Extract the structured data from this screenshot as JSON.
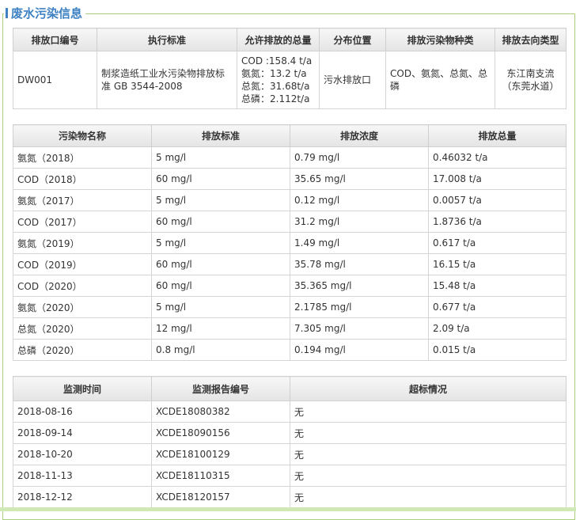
{
  "section_title": "废水污染信息",
  "outlet_table": {
    "headers": [
      "排放口编号",
      "执行标准",
      "允许排放的总量",
      "分布位置",
      "排放污染物种类",
      "排放去向类型"
    ],
    "row": {
      "outlet_id": "DW001",
      "standard": "制浆造纸工业水污染物排放标准 GB 3544-2008",
      "allowed_totals": [
        "COD :158.4 t/a",
        "氨氮：13.2 t/a",
        "总氮：31.68t/a",
        "总磷：2.112t/a"
      ],
      "location": "污水排放口",
      "pollutant_types": "COD、氨氮、总氮、总磷",
      "discharge_destination": "东江南支流（东莞水道）"
    }
  },
  "pollutant_table": {
    "headers": [
      "污染物名称",
      "排放标准",
      "排放浓度",
      "排放总量"
    ],
    "rows": [
      [
        "氨氮（2018）",
        "5 mg/l",
        "0.79 mg/l",
        "0.46032 t/a"
      ],
      [
        "COD（2018）",
        "60 mg/l",
        "35.65 mg/l",
        "17.008 t/a"
      ],
      [
        "氨氮（2017）",
        "5 mg/l",
        "0.12 mg/l",
        "0.0057 t/a"
      ],
      [
        "COD（2017）",
        "60 mg/l",
        "31.2 mg/l",
        "1.8736 t/a"
      ],
      [
        "氨氮（2019）",
        "5 mg/l",
        "1.49 mg/l",
        "0.617 t/a"
      ],
      [
        "COD（2019）",
        "60 mg/l",
        "35.78 mg/l",
        "16.15 t/a"
      ],
      [
        "COD（2020）",
        "60 mg/l",
        "35.365 mg/l",
        "15.48 t/a"
      ],
      [
        "氨氮（2020）",
        "5 mg/l",
        "2.1785 mg/l",
        "0.677 t/a"
      ],
      [
        "总氮（2020）",
        "12 mg/l",
        "7.305 mg/l",
        "2.09 t/a"
      ],
      [
        "总磷（2020）",
        "0.8 mg/l",
        "0.194 mg/l",
        "0.015 t/a"
      ]
    ]
  },
  "monitoring_table": {
    "headers": [
      "监测时间",
      "监测报告编号",
      "超标情况"
    ],
    "rows": [
      [
        "2018-08-16",
        "XCDE18080382",
        "无"
      ],
      [
        "2018-09-14",
        "XCDE18090156",
        "无"
      ],
      [
        "2018-10-20",
        "XCDE18100129",
        "无"
      ],
      [
        "2018-11-13",
        "XCDE18110315",
        "无"
      ],
      [
        "2018-12-12",
        "XCDE18120157",
        "无"
      ]
    ]
  },
  "colors": {
    "title_blue": "#3f82c3",
    "frame_green": "#a9cf7f",
    "header_bg": "#ebebeb"
  }
}
